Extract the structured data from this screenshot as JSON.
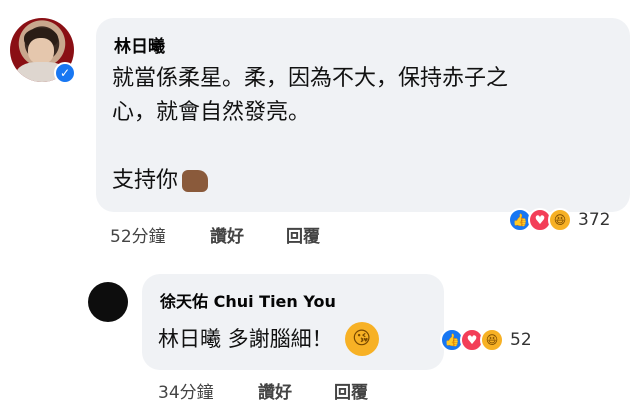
{
  "main_comment": {
    "author": "林日曦",
    "line1": "就當係柔星。柔，因為不大，保持赤子之",
    "line2": "心，就會自然發亮。",
    "line3": "支持你",
    "time": "52分鐘",
    "like_label": "讚好",
    "reply_label": "回覆",
    "reaction_count": "372"
  },
  "reply_comment": {
    "author": "徐天佑 Chui Tien You",
    "text": "林日曦 多謝腦細！",
    "time": "34分鐘",
    "like_label": "讚好",
    "reply_label": "回覆",
    "reaction_count": "52"
  },
  "icons": {
    "verified": "verified-badge-icon",
    "thumbs_up": "thumbs-up-emoji",
    "kiss": "kiss-emoji",
    "like": "like-reaction-icon",
    "love": "love-reaction-icon",
    "haha": "haha-reaction-icon"
  },
  "colors": {
    "bubble": "#f0f2f5",
    "like": "#1877f2",
    "love": "#f33e58",
    "haha": "#f7b125"
  }
}
